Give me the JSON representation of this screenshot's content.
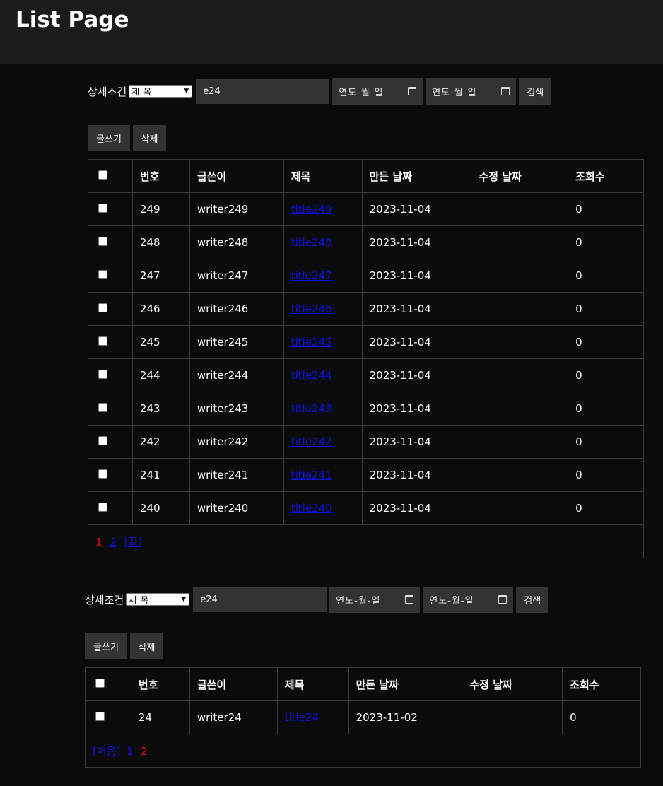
{
  "page": {
    "title": "List Page"
  },
  "search": {
    "label": "상세조건",
    "select_value": "제 목",
    "keyword": "e24",
    "date_from_placeholder": "연도-월-일",
    "date_to_placeholder": "연도-월-일",
    "search_button": "검색"
  },
  "actions": {
    "write": "글쓰기",
    "delete": "삭제"
  },
  "columns": [
    "번호",
    "글쓴이",
    "제목",
    "만든 날짜",
    "수정 날짜",
    "조회수"
  ],
  "list1": {
    "rows": [
      {
        "no": "249",
        "writer": "writer249",
        "title": "title249",
        "created": "2023-11-04",
        "updated": "",
        "views": "0"
      },
      {
        "no": "248",
        "writer": "writer248",
        "title": "title248",
        "created": "2023-11-04",
        "updated": "",
        "views": "0"
      },
      {
        "no": "247",
        "writer": "writer247",
        "title": "title247",
        "created": "2023-11-04",
        "updated": "",
        "views": "0"
      },
      {
        "no": "246",
        "writer": "writer246",
        "title": "title246",
        "created": "2023-11-04",
        "updated": "",
        "views": "0"
      },
      {
        "no": "245",
        "writer": "writer245",
        "title": "title245",
        "created": "2023-11-04",
        "updated": "",
        "views": "0"
      },
      {
        "no": "244",
        "writer": "writer244",
        "title": "title244",
        "created": "2023-11-04",
        "updated": "",
        "views": "0"
      },
      {
        "no": "243",
        "writer": "writer243",
        "title": "title243",
        "created": "2023-11-04",
        "updated": "",
        "views": "0"
      },
      {
        "no": "242",
        "writer": "writer242",
        "title": "title242",
        "created": "2023-11-04",
        "updated": "",
        "views": "0"
      },
      {
        "no": "241",
        "writer": "writer241",
        "title": "title241",
        "created": "2023-11-04",
        "updated": "",
        "views": "0"
      },
      {
        "no": "240",
        "writer": "writer240",
        "title": "title240",
        "created": "2023-11-04",
        "updated": "",
        "views": "0"
      }
    ],
    "pager": {
      "page1": "1",
      "page2": "2",
      "last": "[끝]"
    }
  },
  "list2": {
    "rows": [
      {
        "no": "24",
        "writer": "writer24",
        "title": "title24",
        "created": "2023-11-02",
        "updated": "",
        "views": "0"
      }
    ],
    "pager": {
      "first": "[처음]",
      "page1": "1",
      "page2": "2"
    }
  },
  "colors": {
    "background": "#0b0b0b",
    "header": "#1b1b1b",
    "input": "#333333",
    "link": "#1010dd",
    "current_page": "#e01010"
  }
}
